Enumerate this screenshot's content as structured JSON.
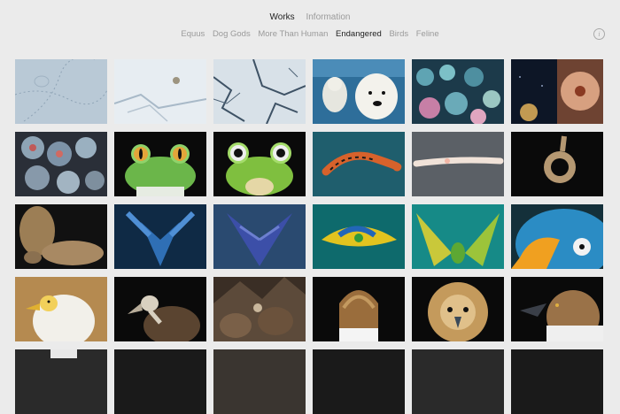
{
  "nav": {
    "items": [
      {
        "label": "Works",
        "active": true
      },
      {
        "label": "Information",
        "active": false
      }
    ]
  },
  "categories": [
    {
      "label": "Equus",
      "active": false
    },
    {
      "label": "Dog Gods",
      "active": false
    },
    {
      "label": "More Than Human",
      "active": false
    },
    {
      "label": "Endangered",
      "active": true
    },
    {
      "label": "Birds",
      "active": false
    },
    {
      "label": "Feline",
      "active": false
    }
  ],
  "info_icon": "info-icon",
  "colors": {
    "background": "#ebebeb",
    "active_text": "#222222",
    "inactive_text": "#9a9a9a"
  }
}
